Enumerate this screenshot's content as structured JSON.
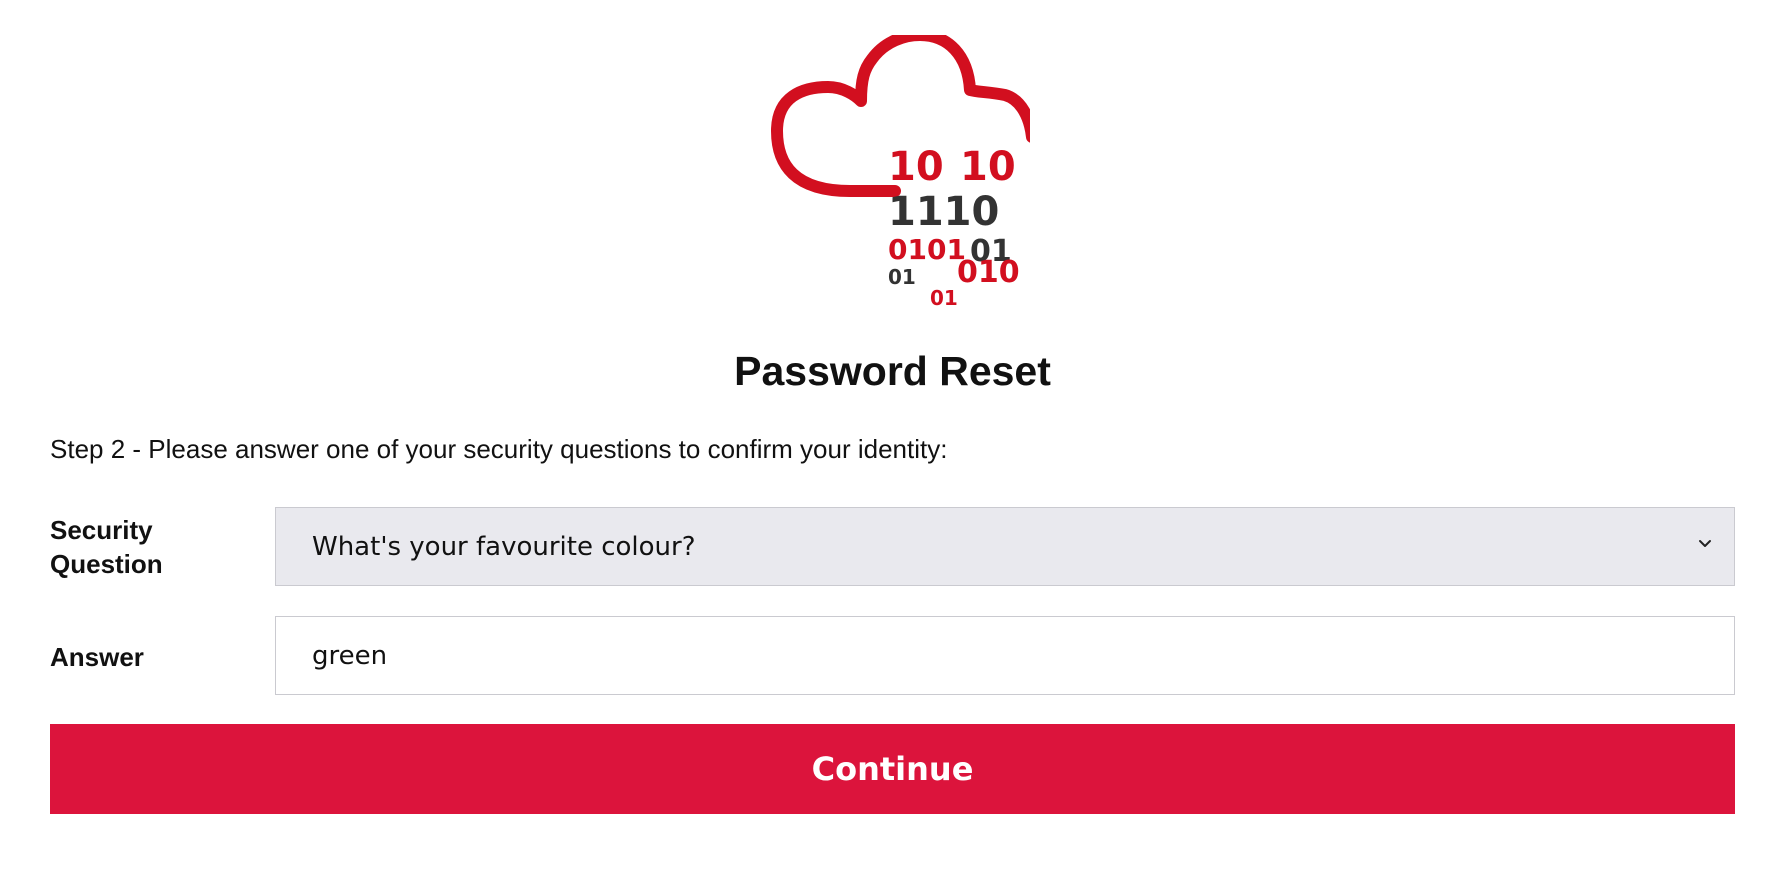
{
  "logo": {
    "icon": "cloud-binary-logo",
    "binary_lines": {
      "row1_left": "10",
      "row1_right": "10",
      "row2": "1110",
      "row3_left": "0101",
      "row3_right": "01",
      "row4_left": "01",
      "row4_right": "010",
      "row5": "01"
    }
  },
  "page": {
    "title": "Password Reset",
    "instruction": "Step 2 - Please answer one of your security questions to confirm your identity:"
  },
  "form": {
    "security_question_label": "Security Question",
    "security_question_value": "What's your favourite colour?",
    "answer_label": "Answer",
    "answer_value": "green",
    "continue_label": "Continue"
  },
  "colors": {
    "brand_red": "#dc143c",
    "logo_red": "#d20f1f",
    "text_dark": "#111111",
    "select_background": "#e9e9ee"
  }
}
